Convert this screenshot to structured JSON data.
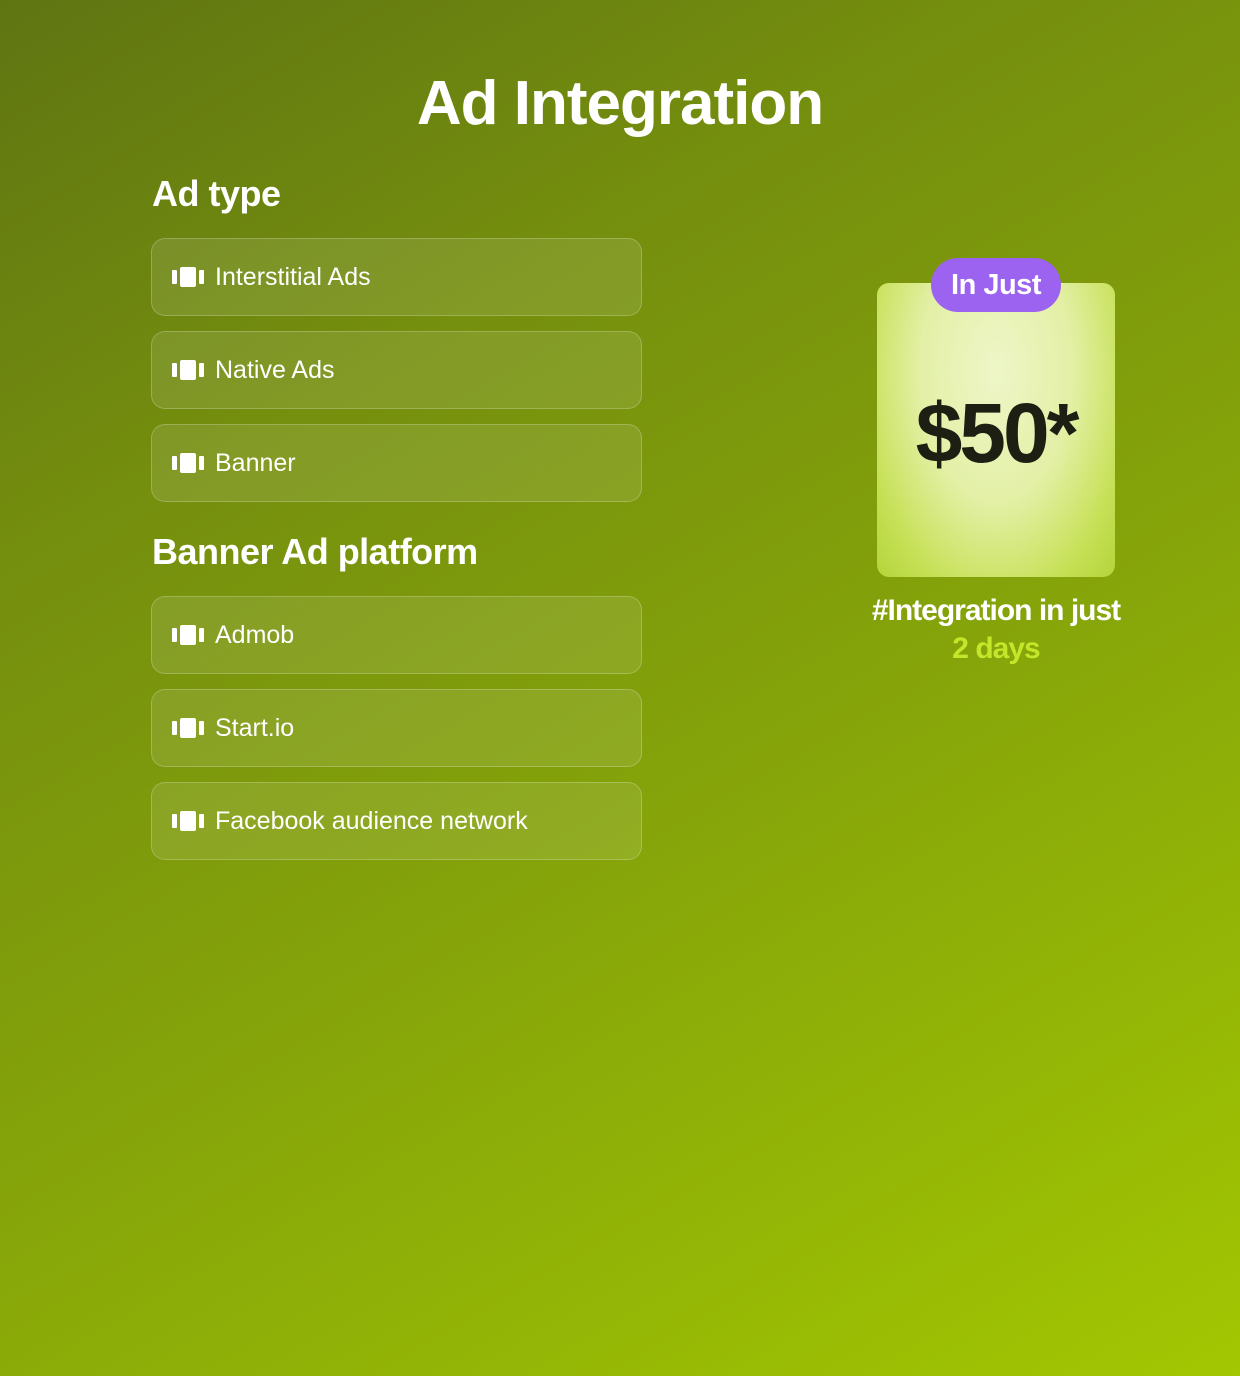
{
  "page": {
    "title": "Ad Integration"
  },
  "ad_type": {
    "title": "Ad type",
    "items": [
      {
        "label": "Interstitial Ads"
      },
      {
        "label": "Native Ads"
      },
      {
        "label": "Banner"
      }
    ]
  },
  "banner_platform": {
    "title": "Banner Ad platform",
    "items": [
      {
        "label": "Admob"
      },
      {
        "label": "Start.io"
      },
      {
        "label": "Facebook audience network"
      }
    ]
  },
  "pricing": {
    "badge": "In Just",
    "price": "$50*",
    "tagline": "#Integration in just",
    "duration": "2 days"
  },
  "icons": {
    "option_icon": "carousel-icon"
  },
  "colors": {
    "badge": "#9b63ef",
    "accent": "#c5e52a",
    "price_text": "#1c1f12"
  }
}
